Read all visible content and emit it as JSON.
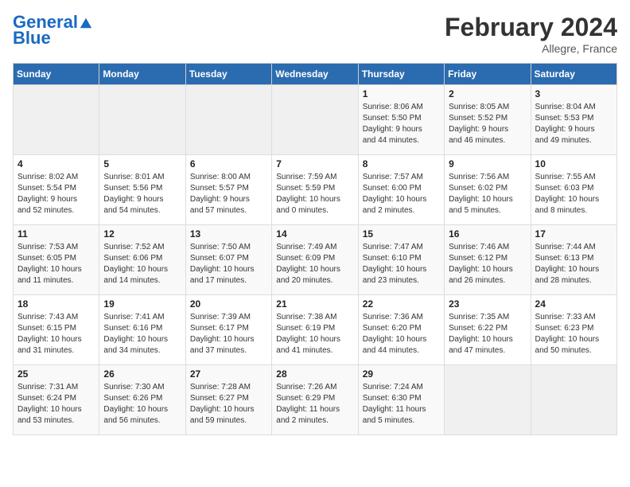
{
  "header": {
    "logo_line1": "General",
    "logo_line2": "Blue",
    "month_title": "February 2024",
    "subtitle": "Allegre, France"
  },
  "weekdays": [
    "Sunday",
    "Monday",
    "Tuesday",
    "Wednesday",
    "Thursday",
    "Friday",
    "Saturday"
  ],
  "weeks": [
    [
      {
        "day": "",
        "info": ""
      },
      {
        "day": "",
        "info": ""
      },
      {
        "day": "",
        "info": ""
      },
      {
        "day": "",
        "info": ""
      },
      {
        "day": "1",
        "info": "Sunrise: 8:06 AM\nSunset: 5:50 PM\nDaylight: 9 hours\nand 44 minutes."
      },
      {
        "day": "2",
        "info": "Sunrise: 8:05 AM\nSunset: 5:52 PM\nDaylight: 9 hours\nand 46 minutes."
      },
      {
        "day": "3",
        "info": "Sunrise: 8:04 AM\nSunset: 5:53 PM\nDaylight: 9 hours\nand 49 minutes."
      }
    ],
    [
      {
        "day": "4",
        "info": "Sunrise: 8:02 AM\nSunset: 5:54 PM\nDaylight: 9 hours\nand 52 minutes."
      },
      {
        "day": "5",
        "info": "Sunrise: 8:01 AM\nSunset: 5:56 PM\nDaylight: 9 hours\nand 54 minutes."
      },
      {
        "day": "6",
        "info": "Sunrise: 8:00 AM\nSunset: 5:57 PM\nDaylight: 9 hours\nand 57 minutes."
      },
      {
        "day": "7",
        "info": "Sunrise: 7:59 AM\nSunset: 5:59 PM\nDaylight: 10 hours\nand 0 minutes."
      },
      {
        "day": "8",
        "info": "Sunrise: 7:57 AM\nSunset: 6:00 PM\nDaylight: 10 hours\nand 2 minutes."
      },
      {
        "day": "9",
        "info": "Sunrise: 7:56 AM\nSunset: 6:02 PM\nDaylight: 10 hours\nand 5 minutes."
      },
      {
        "day": "10",
        "info": "Sunrise: 7:55 AM\nSunset: 6:03 PM\nDaylight: 10 hours\nand 8 minutes."
      }
    ],
    [
      {
        "day": "11",
        "info": "Sunrise: 7:53 AM\nSunset: 6:05 PM\nDaylight: 10 hours\nand 11 minutes."
      },
      {
        "day": "12",
        "info": "Sunrise: 7:52 AM\nSunset: 6:06 PM\nDaylight: 10 hours\nand 14 minutes."
      },
      {
        "day": "13",
        "info": "Sunrise: 7:50 AM\nSunset: 6:07 PM\nDaylight: 10 hours\nand 17 minutes."
      },
      {
        "day": "14",
        "info": "Sunrise: 7:49 AM\nSunset: 6:09 PM\nDaylight: 10 hours\nand 20 minutes."
      },
      {
        "day": "15",
        "info": "Sunrise: 7:47 AM\nSunset: 6:10 PM\nDaylight: 10 hours\nand 23 minutes."
      },
      {
        "day": "16",
        "info": "Sunrise: 7:46 AM\nSunset: 6:12 PM\nDaylight: 10 hours\nand 26 minutes."
      },
      {
        "day": "17",
        "info": "Sunrise: 7:44 AM\nSunset: 6:13 PM\nDaylight: 10 hours\nand 28 minutes."
      }
    ],
    [
      {
        "day": "18",
        "info": "Sunrise: 7:43 AM\nSunset: 6:15 PM\nDaylight: 10 hours\nand 31 minutes."
      },
      {
        "day": "19",
        "info": "Sunrise: 7:41 AM\nSunset: 6:16 PM\nDaylight: 10 hours\nand 34 minutes."
      },
      {
        "day": "20",
        "info": "Sunrise: 7:39 AM\nSunset: 6:17 PM\nDaylight: 10 hours\nand 37 minutes."
      },
      {
        "day": "21",
        "info": "Sunrise: 7:38 AM\nSunset: 6:19 PM\nDaylight: 10 hours\nand 41 minutes."
      },
      {
        "day": "22",
        "info": "Sunrise: 7:36 AM\nSunset: 6:20 PM\nDaylight: 10 hours\nand 44 minutes."
      },
      {
        "day": "23",
        "info": "Sunrise: 7:35 AM\nSunset: 6:22 PM\nDaylight: 10 hours\nand 47 minutes."
      },
      {
        "day": "24",
        "info": "Sunrise: 7:33 AM\nSunset: 6:23 PM\nDaylight: 10 hours\nand 50 minutes."
      }
    ],
    [
      {
        "day": "25",
        "info": "Sunrise: 7:31 AM\nSunset: 6:24 PM\nDaylight: 10 hours\nand 53 minutes."
      },
      {
        "day": "26",
        "info": "Sunrise: 7:30 AM\nSunset: 6:26 PM\nDaylight: 10 hours\nand 56 minutes."
      },
      {
        "day": "27",
        "info": "Sunrise: 7:28 AM\nSunset: 6:27 PM\nDaylight: 10 hours\nand 59 minutes."
      },
      {
        "day": "28",
        "info": "Sunrise: 7:26 AM\nSunset: 6:29 PM\nDaylight: 11 hours\nand 2 minutes."
      },
      {
        "day": "29",
        "info": "Sunrise: 7:24 AM\nSunset: 6:30 PM\nDaylight: 11 hours\nand 5 minutes."
      },
      {
        "day": "",
        "info": ""
      },
      {
        "day": "",
        "info": ""
      }
    ]
  ]
}
